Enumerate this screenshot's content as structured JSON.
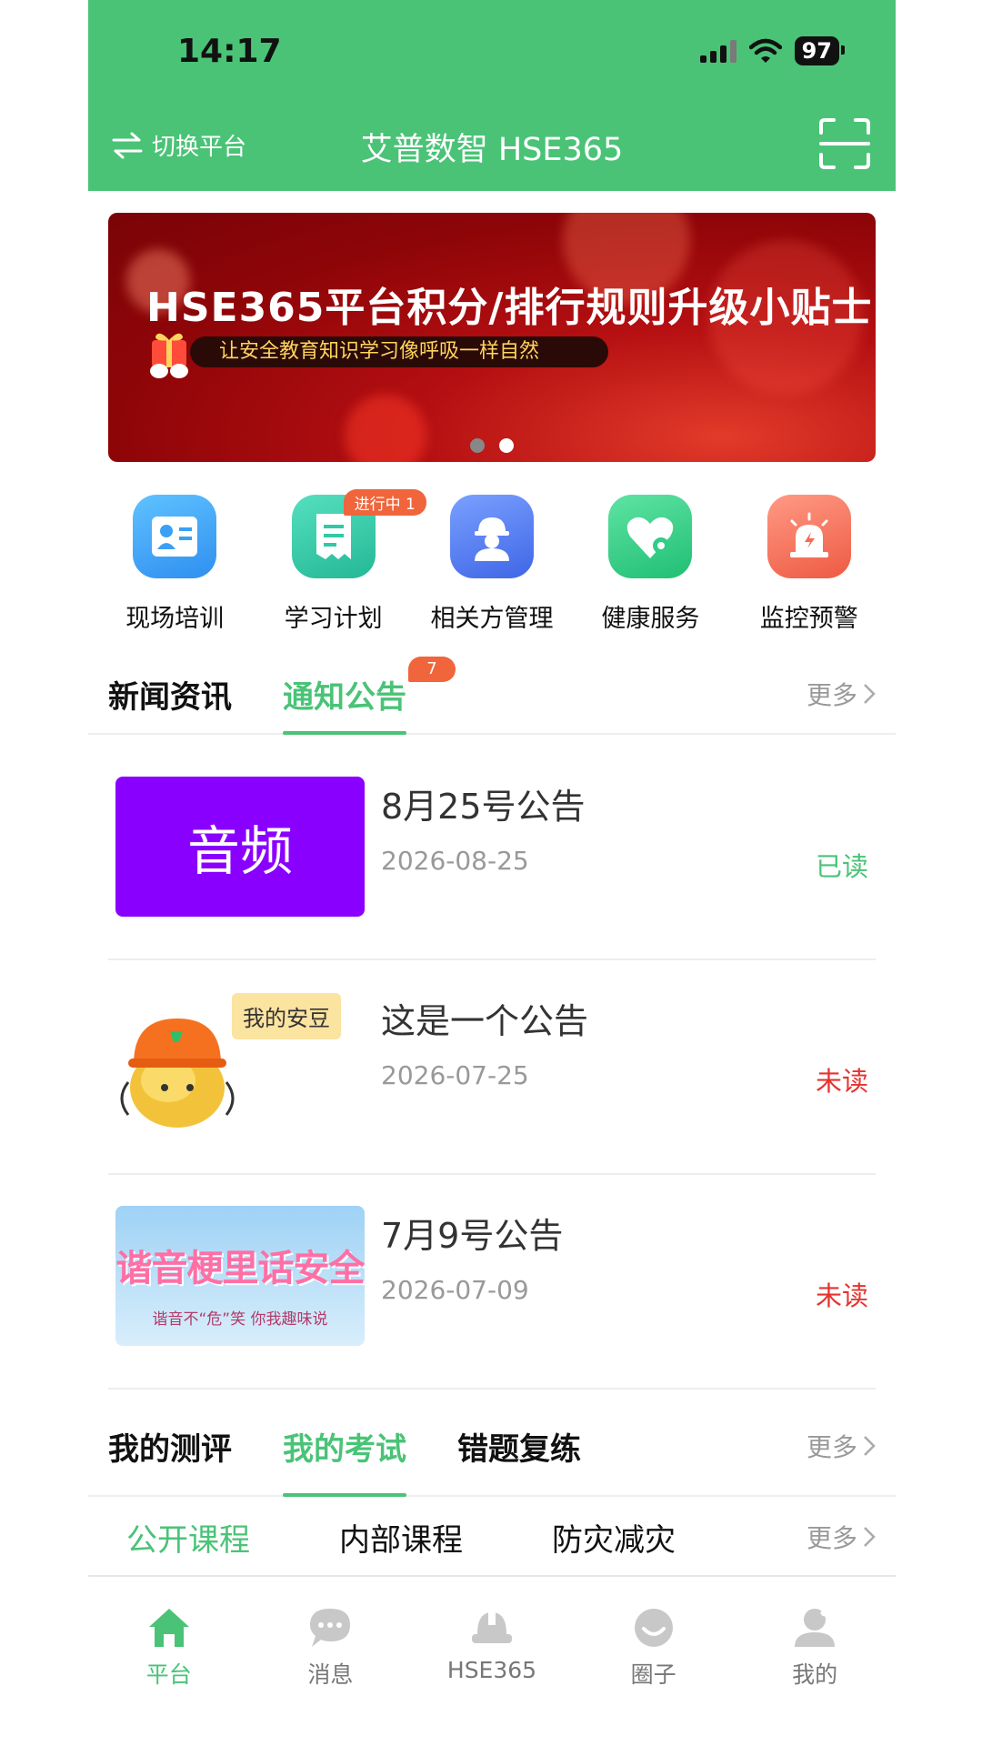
{
  "status_bar": {
    "time": "14:17",
    "battery": "97"
  },
  "header": {
    "switch_label": "切换平台",
    "title": "艾普数智 HSE365"
  },
  "banner": {
    "title": "HSE365平台积分/排行规则升级小贴士",
    "subtitle": "让安全教育知识学习像呼吸一样自然"
  },
  "quick_actions": [
    {
      "label": "现场培训",
      "icon": "training-icon",
      "color": "#3aa0f5"
    },
    {
      "label": "学习计划",
      "icon": "study-plan-icon",
      "color": "#30c9a6",
      "badge": "进行中 1"
    },
    {
      "label": "相关方管理",
      "icon": "contractor-icon",
      "color": "#4f7bf0"
    },
    {
      "label": "健康服务",
      "icon": "health-icon",
      "color": "#2fcd86"
    },
    {
      "label": "监控预警",
      "icon": "alarm-icon",
      "color": "#f36b55"
    }
  ],
  "news_tabs": {
    "tab1": "新闻资讯",
    "tab2": "通知公告",
    "tab2_badge": "7",
    "more": "更多"
  },
  "notices": [
    {
      "thumb_text": "音频",
      "title": "8月25号公告",
      "date": "2026-08-25",
      "status": "已读"
    },
    {
      "thumb_text": "我的安豆",
      "title": "这是一个公告",
      "date": "2026-07-25",
      "status": "未读"
    },
    {
      "thumb_text": "谐音梗里话安全",
      "thumb_sub": "谐音不“危”笑 你我趣味说",
      "title": "7月9号公告",
      "date": "2026-07-09",
      "status": "未读"
    }
  ],
  "exam_tabs": {
    "tab1": "我的测评",
    "tab2": "我的考试",
    "tab3": "错题复练",
    "more": "更多"
  },
  "course_tabs": {
    "tab1": "公开课程",
    "tab2": "内部课程",
    "tab3": "防灾减灾",
    "more": "更多"
  },
  "bottom_nav": [
    {
      "label": "平台",
      "icon": "home-icon"
    },
    {
      "label": "消息",
      "icon": "message-icon"
    },
    {
      "label": "HSE365",
      "icon": "hse-icon"
    },
    {
      "label": "圈子",
      "icon": "circle-icon"
    },
    {
      "label": "我的",
      "icon": "profile-icon"
    }
  ],
  "colors": {
    "brand": "#4ac377",
    "unread": "#e5332f",
    "audio_thumb": "#8a00ff",
    "badge": "#f0653b"
  }
}
